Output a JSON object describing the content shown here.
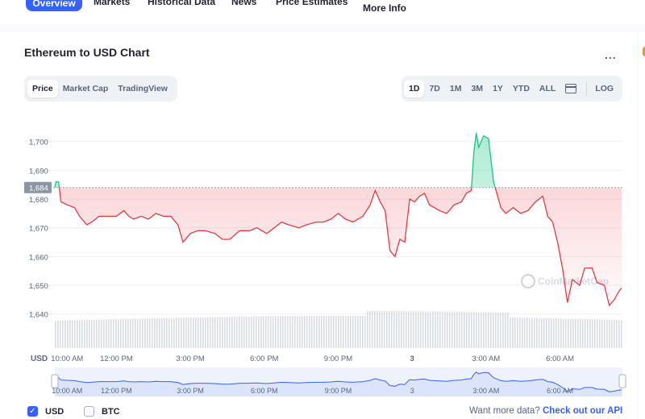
{
  "nav": {
    "active": "Overview",
    "items": [
      "Markets",
      "Historical Data",
      "News",
      "Price Estimates"
    ],
    "more": "More Info"
  },
  "header": {
    "title": "Ethereum to USD Chart",
    "more_menu": "..."
  },
  "chart_tabs": [
    "Price",
    "Market Cap",
    "TradingView"
  ],
  "range_tabs": [
    "1D",
    "7D",
    "1M",
    "3M",
    "1Y",
    "YTD",
    "ALL"
  ],
  "scale_label": "LOG",
  "colors": {
    "up": "#16c784",
    "down": "#ea3943",
    "accent": "#3861fb",
    "nav": "#3861fb"
  },
  "chart_data": {
    "type": "line",
    "title": "Ethereum to USD Chart",
    "ylabel": "USD",
    "ylim": [
      1636,
      1710
    ],
    "yticks": [
      1640,
      1650,
      1660,
      1670,
      1680,
      1690,
      1700
    ],
    "ytick_labels": [
      "1,640",
      "1,650",
      "1,660",
      "1,670",
      "1,680",
      "1,690",
      "1,700"
    ],
    "xticks": [
      {
        "label": "10:00 AM",
        "t": 0.5
      },
      {
        "label": "12:00 PM",
        "t": 2.5
      },
      {
        "label": "3:00 PM",
        "t": 5.5
      },
      {
        "label": "6:00 PM",
        "t": 8.5
      },
      {
        "label": "9:00 PM",
        "t": 11.5
      },
      {
        "label": "3",
        "t": 14.5
      },
      {
        "label": "3:00 AM",
        "t": 17.5
      },
      {
        "label": "6:00 AM",
        "t": 20.5
      }
    ],
    "reference": {
      "value": 1684,
      "label": "1,684"
    },
    "series": [
      {
        "points": [
          [
            0,
            1684
          ],
          [
            0.05,
            1686
          ],
          [
            0.15,
            1686
          ],
          [
            0.25,
            1679
          ],
          [
            0.5,
            1678
          ],
          [
            0.8,
            1677
          ],
          [
            1.0,
            1674
          ],
          [
            1.3,
            1671
          ],
          [
            1.5,
            1672
          ],
          [
            1.8,
            1674
          ],
          [
            2.1,
            1674
          ],
          [
            2.5,
            1674
          ],
          [
            2.8,
            1676
          ],
          [
            3.0,
            1674
          ],
          [
            3.2,
            1673
          ],
          [
            3.5,
            1674
          ],
          [
            3.8,
            1673
          ],
          [
            4.1,
            1675
          ],
          [
            4.4,
            1674
          ],
          [
            4.7,
            1674
          ],
          [
            5.0,
            1671
          ],
          [
            5.2,
            1665
          ],
          [
            5.5,
            1668
          ],
          [
            5.8,
            1669
          ],
          [
            6.1,
            1669
          ],
          [
            6.5,
            1668
          ],
          [
            6.8,
            1666
          ],
          [
            7.1,
            1666
          ],
          [
            7.5,
            1669
          ],
          [
            7.9,
            1669
          ],
          [
            8.2,
            1670
          ],
          [
            8.6,
            1668
          ],
          [
            8.9,
            1670
          ],
          [
            9.2,
            1672
          ],
          [
            9.5,
            1671
          ],
          [
            9.9,
            1670
          ],
          [
            10.2,
            1671
          ],
          [
            10.6,
            1672
          ],
          [
            10.9,
            1672
          ],
          [
            11.2,
            1673
          ],
          [
            11.5,
            1675
          ],
          [
            11.8,
            1673
          ],
          [
            12.1,
            1672
          ],
          [
            12.5,
            1674
          ],
          [
            12.8,
            1678
          ],
          [
            13.0,
            1683
          ],
          [
            13.2,
            1679
          ],
          [
            13.4,
            1676
          ],
          [
            13.6,
            1662
          ],
          [
            13.8,
            1660
          ],
          [
            14.0,
            1666
          ],
          [
            14.2,
            1665
          ],
          [
            14.4,
            1680
          ],
          [
            14.6,
            1679
          ],
          [
            14.8,
            1681
          ],
          [
            15.0,
            1682
          ],
          [
            15.2,
            1678
          ],
          [
            15.4,
            1677
          ],
          [
            15.6,
            1676
          ],
          [
            15.9,
            1675
          ],
          [
            16.2,
            1678
          ],
          [
            16.5,
            1679
          ],
          [
            16.7,
            1682
          ],
          [
            16.9,
            1683
          ],
          [
            17.0,
            1696
          ],
          [
            17.1,
            1703
          ],
          [
            17.2,
            1698
          ],
          [
            17.4,
            1702
          ],
          [
            17.6,
            1701
          ],
          [
            17.8,
            1686
          ],
          [
            18.0,
            1680
          ],
          [
            18.1,
            1677
          ],
          [
            18.3,
            1675
          ],
          [
            18.6,
            1677
          ],
          [
            18.9,
            1675
          ],
          [
            19.2,
            1676
          ],
          [
            19.5,
            1679
          ],
          [
            19.8,
            1681
          ],
          [
            20.0,
            1674
          ],
          [
            20.2,
            1672
          ],
          [
            20.4,
            1665
          ],
          [
            20.6,
            1656
          ],
          [
            20.8,
            1644
          ],
          [
            21.0,
            1652
          ],
          [
            21.3,
            1650
          ],
          [
            21.5,
            1656
          ],
          [
            21.8,
            1656
          ],
          [
            22.0,
            1651
          ],
          [
            22.3,
            1650
          ],
          [
            22.5,
            1643
          ],
          [
            22.7,
            1645
          ],
          [
            22.9,
            1648
          ],
          [
            23.0,
            1649
          ]
        ]
      }
    ],
    "grid": true,
    "watermark": "CoinMarketCap"
  },
  "axis_unit": "USD",
  "navigator_labels": [
    "10:00 AM",
    "12:00 PM",
    "3:00 PM",
    "6:00 PM",
    "9:00 PM",
    "3",
    "3:00 AM",
    "6:00 AM"
  ],
  "legend": {
    "usd": "USD",
    "btc": "BTC",
    "usd_checked": true,
    "btc_checked": false
  },
  "footer": {
    "prompt": "Want more data?",
    "link": "Check out our API"
  }
}
